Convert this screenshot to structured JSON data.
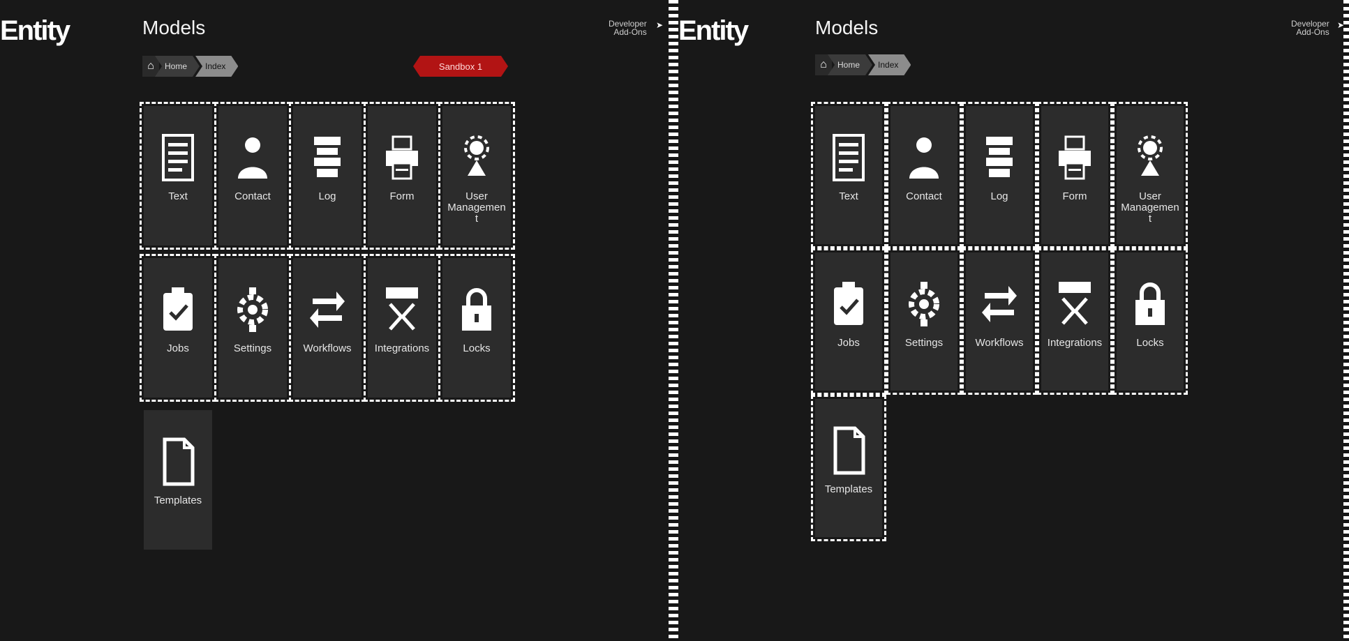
{
  "left": {
    "app_name": "Entity",
    "page_title": "Models",
    "top_link": {
      "line1": "Developer",
      "line2": "Add-Ons"
    },
    "breadcrumb": {
      "item1": "Home",
      "item2": "Index"
    },
    "sandbox_label": "Sandbox 1",
    "tiles": [
      {
        "label": "Text",
        "icon": "document-list-icon"
      },
      {
        "label": "Contact",
        "icon": "contact-user-icon"
      },
      {
        "label": "Log",
        "icon": "log-stack-icon"
      },
      {
        "label": "Form",
        "icon": "form-printer-icon"
      },
      {
        "label": "User Management",
        "icon": "user-gear-icon"
      },
      {
        "label": "Jobs",
        "icon": "jobs-check-icon"
      },
      {
        "label": "Settings",
        "icon": "settings-gear-icon"
      },
      {
        "label": "Workflows",
        "icon": "workflow-arrows-icon"
      },
      {
        "label": "Integrations",
        "icon": "integration-plug-icon"
      },
      {
        "label": "Locks",
        "icon": "lock-icon"
      },
      {
        "label": "Templates",
        "icon": "template-file-icon"
      }
    ]
  },
  "right": {
    "app_name": "Entity",
    "page_title": "Models",
    "top_link": {
      "line1": "Developer",
      "line2": "Add-Ons"
    },
    "breadcrumb": {
      "item1": "Home",
      "item2": "Index"
    },
    "tiles": [
      {
        "label": "Text",
        "icon": "document-list-icon"
      },
      {
        "label": "Contact",
        "icon": "contact-user-icon"
      },
      {
        "label": "Log",
        "icon": "log-stack-icon"
      },
      {
        "label": "Form",
        "icon": "form-printer-icon"
      },
      {
        "label": "User Management",
        "icon": "user-gear-icon"
      },
      {
        "label": "Jobs",
        "icon": "jobs-check-icon"
      },
      {
        "label": "Settings",
        "icon": "settings-gear-icon"
      },
      {
        "label": "Workflows",
        "icon": "workflow-arrows-icon"
      },
      {
        "label": "Integrations",
        "icon": "integration-plug-icon"
      },
      {
        "label": "Locks",
        "icon": "lock-icon"
      },
      {
        "label": "Templates",
        "icon": "template-file-icon"
      }
    ]
  },
  "colors": {
    "background": "#181818",
    "tile": "#2c2c2c",
    "badge": "#b21414",
    "dash": "#ffffff"
  }
}
